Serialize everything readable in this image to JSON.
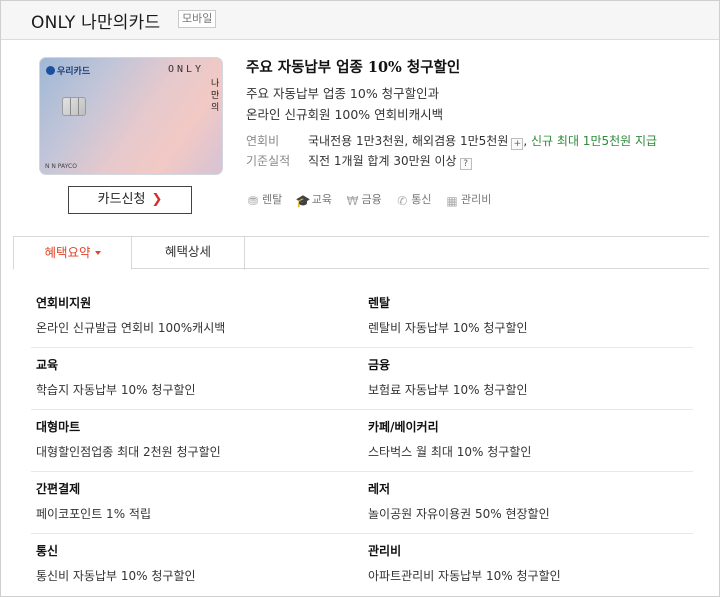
{
  "header": {
    "title": "ONLY 나만의카드",
    "badge": "모바일"
  },
  "card_image": {
    "issuer": "우리카드",
    "brand": "ONLY",
    "vertical_text": "나만의",
    "footer": "N N PAYCO"
  },
  "apply_button": {
    "label": "카드신청",
    "arrow": "❯"
  },
  "card_info": {
    "name": "주요 자동납부 업종 10% 청구할인",
    "lines": [
      "주요 자동납부 업종 10% 청구할인과",
      "온라인 신규회원 100% 연회비캐시백"
    ]
  },
  "annual_fee": {
    "label": "연회비",
    "value": "국내전용 1만3천원, 해외겸용 1만5천원",
    "plus": "+",
    "separator": ",",
    "promo": "신규 최대 1만5천원 지급"
  },
  "performance": {
    "label": "기준실적",
    "value": "직전 1개월 합계 30만원 이상",
    "help": "?"
  },
  "categories": [
    {
      "icon": "rental-icon",
      "label": "렌탈"
    },
    {
      "icon": "education-icon",
      "label": "교육"
    },
    {
      "icon": "finance-icon",
      "label": "금융"
    },
    {
      "icon": "phone-icon",
      "label": "통신"
    },
    {
      "icon": "building-icon",
      "label": "관리비"
    }
  ],
  "tabs": [
    {
      "label": "혜택요약",
      "active": true
    },
    {
      "label": "혜택상세",
      "active": false
    }
  ],
  "benefits": [
    {
      "left": {
        "title": "연회비지원",
        "text": "온라인 신규발급 연회비 100%캐시백"
      },
      "right": {
        "title": "렌탈",
        "text": "렌탈비 자동납부 10% 청구할인"
      }
    },
    {
      "left": {
        "title": "교육",
        "text": "학습지 자동납부 10% 청구할인"
      },
      "right": {
        "title": "금융",
        "text": "보험료 자동납부 10% 청구할인"
      }
    },
    {
      "left": {
        "title": "대형마트",
        "text": "대형할인점업종 최대 2천원 청구할인"
      },
      "right": {
        "title": "카페/베이커리",
        "text": "스타벅스 월 최대 10% 청구할인"
      }
    },
    {
      "left": {
        "title": "간편결제",
        "text": "페이코포인트 1% 적립"
      },
      "right": {
        "title": "레저",
        "text": "놀이공원 자유이용권 50% 현장할인"
      }
    },
    {
      "left": {
        "title": "통신",
        "text": "통신비 자동납부 10% 청구할인"
      },
      "right": {
        "title": "관리비",
        "text": "아파트관리비 자동납부 10% 청구할인"
      }
    }
  ],
  "colors": {
    "accent": "#e0442a",
    "promo_green": "#2e8b3a",
    "button_arrow": "#d32f2f"
  }
}
